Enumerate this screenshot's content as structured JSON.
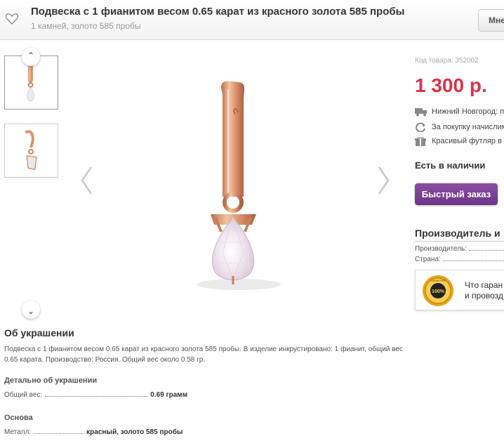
{
  "header": {
    "title": "Подвеска с 1 фианитом весом 0.65 карат из красного золота 585 пробы",
    "subtitle": "1 камней, золото 585 пробы",
    "more_button": "Мне"
  },
  "gallery": {
    "up_icon": "chevron-up-icon",
    "down_icon": "chevron-down-icon",
    "thumbnails": 2,
    "prev_icon": "chevron-left-icon",
    "next_icon": "chevron-right-icon"
  },
  "product": {
    "sku_label": "Код товара: 352002",
    "price": "1 300 р.",
    "features": [
      {
        "icon": "truck-icon",
        "text": "Нижний Новгород: п"
      },
      {
        "icon": "refresh-icon",
        "text": "За покупку начислим"
      },
      {
        "icon": "gift-icon",
        "text": "Красивый футляр в"
      }
    ],
    "stock": "Есть в наличии",
    "quick_order": "Быстрый заказ"
  },
  "manufacturer": {
    "title": "Производитель и",
    "rows": [
      {
        "label": "Производитель:"
      },
      {
        "label": "Страна:"
      }
    ],
    "guarantee_line1": "Что гаран",
    "guarantee_line2": "и провозд",
    "seal_top": "ГАРАНТИЯ",
    "seal_center": "100%"
  },
  "about": {
    "title": "Об украшении",
    "text": "Подвеска с 1 фианитом весом 0.65 карат из красного золота 585 пробы. В изделие инкрустировано: 1 фианит, общий вес 0.65 карата. Производство: Россия. Общий вес около 0.58 гр.",
    "details_title": "Детально об украшении",
    "weight_label": "Общий вес:",
    "weight_value": "0.69 грамм",
    "base_title": "Основа",
    "metal_label": "Металл:",
    "metal_value": "красный, золото 585 пробы"
  },
  "colors": {
    "price": "#d9344c",
    "button": "#7a3f94",
    "gold": "#d9916a"
  }
}
